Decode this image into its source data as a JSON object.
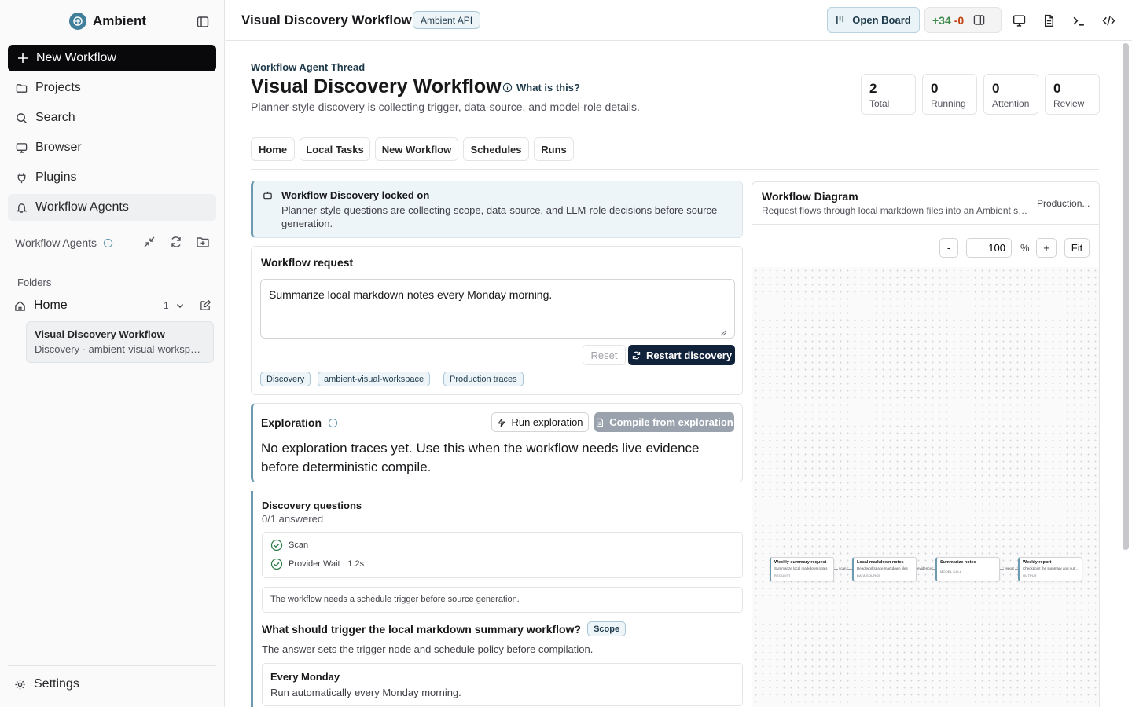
{
  "sidebar": {
    "brand": "Ambient",
    "new_workflow": "New Workflow",
    "nav": [
      {
        "label": "Projects",
        "icon": "folder-icon"
      },
      {
        "label": "Search",
        "icon": "search-icon"
      },
      {
        "label": "Browser",
        "icon": "monitor-icon"
      },
      {
        "label": "Plugins",
        "icon": "plug-icon"
      },
      {
        "label": "Workflow Agents",
        "icon": "bell-icon",
        "active": true
      }
    ],
    "agents_header": "Workflow Agents",
    "folders_label": "Folders",
    "home": {
      "label": "Home",
      "count": "1"
    },
    "workflow_card": {
      "title": "Visual Discovery Workflow",
      "subtitle": "Discovery · ambient-visual-workspace"
    },
    "settings": "Settings"
  },
  "topbar": {
    "title": "Visual Discovery Workflow",
    "badge": "Ambient API",
    "open_board": "Open Board",
    "diff_plus": "+34",
    "diff_minus": "-0"
  },
  "header": {
    "eyebrow": "Workflow Agent Thread",
    "title": "Visual Discovery Workflow",
    "what_is_this": "What is this?",
    "subtitle": "Planner-style discovery is collecting trigger, data-source, and model-role details.",
    "stats": [
      {
        "value": "2",
        "label": "Total"
      },
      {
        "value": "0",
        "label": "Running"
      },
      {
        "value": "0",
        "label": "Attention"
      },
      {
        "value": "0",
        "label": "Review"
      }
    ]
  },
  "tabs": [
    "Home",
    "Local Tasks",
    "New Workflow",
    "Schedules",
    "Runs"
  ],
  "locked": {
    "title": "Workflow Discovery locked on",
    "description": "Planner-style questions are collecting scope, data-source, and LLM-role decisions before source generation."
  },
  "request": {
    "title": "Workflow request",
    "value": "Summarize local markdown notes every Monday morning.",
    "reset": "Reset",
    "restart": "Restart discovery",
    "chips": [
      "Discovery",
      "ambient-visual-workspace",
      "Production traces"
    ]
  },
  "exploration": {
    "title": "Exploration",
    "run": "Run exploration",
    "compile": "Compile from exploration",
    "message": "No exploration traces yet. Use this when the workflow needs live evidence before deterministic compile."
  },
  "discovery": {
    "title": "Discovery questions",
    "answered": "0/1 answered",
    "steps": [
      "Scan",
      "Provider Wait · 1.2s"
    ],
    "note": "The workflow needs a schedule trigger before source generation.",
    "question": "What should trigger the local markdown summary workflow?",
    "question_tag": "Scope",
    "question_desc": "The answer sets the trigger node and schedule policy before compilation.",
    "option": {
      "title": "Every Monday",
      "description": "Run automatically every Monday morning."
    }
  },
  "diagram": {
    "title": "Workflow Diagram",
    "subtitle": "Request flows through local markdown files into an Ambient summary",
    "mode": "Production...",
    "zoom_minus": "-",
    "zoom_value": "100",
    "zoom_unit": "%",
    "zoom_plus": "+",
    "fit": "Fit",
    "nodes": [
      {
        "title": "Weekly summary request",
        "desc": "Summarize local markdown notes",
        "kind": "REQUEST"
      },
      {
        "title": "Local markdown notes",
        "desc": "Read workspace markdown files",
        "kind": "DATA SOURCE"
      },
      {
        "title": "Summarize notes",
        "desc": "",
        "kind": "MODEL CALL"
      },
      {
        "title": "Weekly report",
        "desc": "Checkpoint the summary and output",
        "kind": "OUTPUT"
      }
    ],
    "edges": [
      "scan",
      "evidence",
      "report"
    ]
  }
}
